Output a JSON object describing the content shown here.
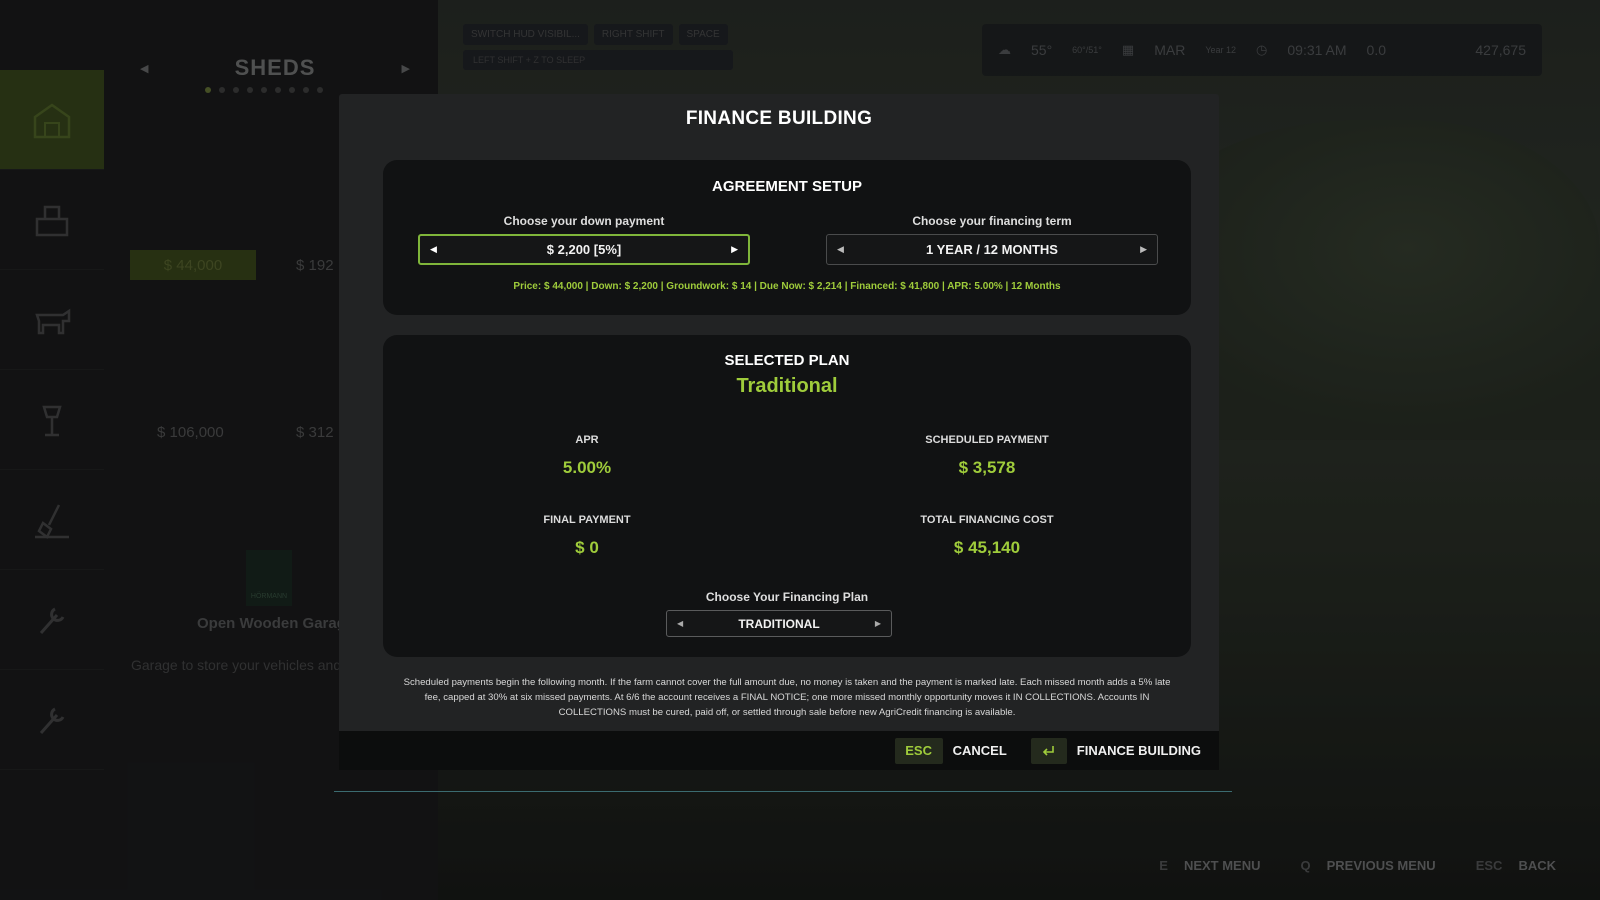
{
  "background": {
    "sheds_title": "SHEDS",
    "shop_items": [
      {
        "price": "$ 44,000"
      },
      {
        "price": "$ 192"
      },
      {
        "price": "$ 106,000"
      },
      {
        "price": "$ 312"
      }
    ],
    "selected_item": {
      "name": "Open Wooden Garage",
      "description": "Garage to store your vehicles and",
      "brand": "HÖRMANN"
    },
    "key_hints": [
      "SWITCH HUD VISIBIL...",
      "RIGHT SHIFT",
      "SPACE"
    ],
    "key_hint_sleep": "LEFT SHIFT + Z TO SLEEP",
    "hud": {
      "temperature": "55°",
      "temperature_range": "60°/51°",
      "month": "MAR",
      "month_sub": "Year 12",
      "time": "09:31 AM",
      "speed": "0.0",
      "money": "427,675"
    },
    "bottom_nav": [
      {
        "key": "E",
        "label": "NEXT MENU"
      },
      {
        "key": "Q",
        "label": "PREVIOUS MENU"
      },
      {
        "key": "ESC",
        "label": "BACK"
      }
    ]
  },
  "modal": {
    "title": "FINANCE BUILDING",
    "agreement": {
      "title": "AGREEMENT SETUP",
      "down_payment_label": "Choose your down payment",
      "down_payment_value": "$ 2,200 [5%]",
      "term_label": "Choose your financing term",
      "term_value": "1 YEAR / 12 MONTHS",
      "summary": "Price: $ 44,000 | Down: $ 2,200 | Groundwork: $ 14 | Due Now: $ 2,214 | Financed: $ 41,800 | APR: 5.00% | 12 Months"
    },
    "plan": {
      "title": "SELECTED PLAN",
      "name": "Traditional",
      "apr_label": "APR",
      "apr_value": "5.00%",
      "scheduled_label": "SCHEDULED PAYMENT",
      "scheduled_value": "$ 3,578",
      "final_label": "FINAL PAYMENT",
      "final_value": "$ 0",
      "total_label": "TOTAL FINANCING COST",
      "total_value": "$ 45,140",
      "choose_label": "Choose Your Financing Plan",
      "choose_value": "TRADITIONAL"
    },
    "disclaimer": "Scheduled payments begin the following month. If the farm cannot cover the full amount due, no money is taken and the payment is marked late. Each missed month adds a 5% late fee, capped at 30% at six missed payments. At 6/6 the account receives a FINAL NOTICE; one more missed monthly opportunity moves it IN COLLECTIONS. Accounts IN COLLECTIONS must be cured, paid off, or settled through sale before new AgriCredit financing is available.",
    "footer": {
      "esc_key": "ESC",
      "cancel_label": "CANCEL",
      "confirm_label": "FINANCE BUILDING"
    }
  },
  "colors": {
    "accent_green": "#9fcc3b",
    "active_border": "#7fb53a",
    "panel_bg": "#111213",
    "modal_bg": "#222324"
  }
}
